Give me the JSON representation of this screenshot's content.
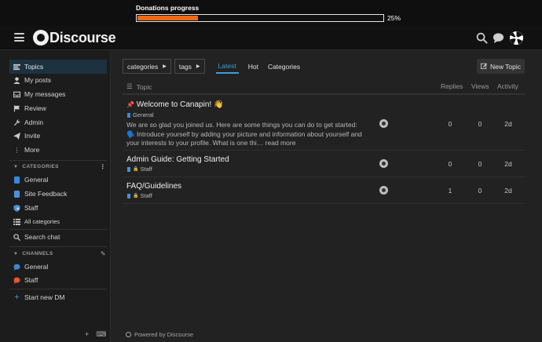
{
  "banner": {
    "title": "Donations progress",
    "percent_label": "25%",
    "progress": 0.25
  },
  "header": {
    "logo_text": "Discourse",
    "icons": [
      "hamburger-icon",
      "search-icon",
      "chat-icon",
      "user-avatar"
    ]
  },
  "sidebar": {
    "items": [
      {
        "label": "Topics",
        "icon": "topics-icon"
      },
      {
        "label": "My posts",
        "icon": "user-icon"
      },
      {
        "label": "My messages",
        "icon": "inbox-icon"
      },
      {
        "label": "Review",
        "icon": "flag-icon"
      },
      {
        "label": "Admin",
        "icon": "wrench-icon"
      },
      {
        "label": "Invite",
        "icon": "paper-plane-icon"
      },
      {
        "label": "More",
        "icon": "ellipsis-icon"
      }
    ],
    "categories_heading": "CATEGORIES",
    "categories": [
      {
        "label": "General",
        "color": "#3a87d6"
      },
      {
        "label": "Site Feedback",
        "color": "#4a90d6"
      },
      {
        "label": "Staff",
        "color": "#4a90d6"
      }
    ],
    "all_categories": "All categories",
    "search_chat": "Search chat",
    "channels_heading": "CHANNELS",
    "channels": [
      {
        "label": "General",
        "color": "#3a87d6"
      },
      {
        "label": "Staff",
        "color": "#e45735"
      }
    ],
    "start_dm": "Start new DM"
  },
  "nav": {
    "categories_drop": "categories",
    "tags_drop": "tags",
    "tabs": [
      "Latest",
      "Hot",
      "Categories"
    ],
    "active_tab": "Latest",
    "new_topic": "New Topic"
  },
  "table": {
    "headers": {
      "topic": "Topic",
      "replies": "Replies",
      "views": "Views",
      "activity": "Activity"
    },
    "rows": [
      {
        "title": "Welcome to Canapin! 👋",
        "category": "General",
        "excerpt": "We are so glad you joined us. Here are some things you can do to get started: 🗣️ Introduce yourself by adding your picture and information about yourself and your interests to your profile. What is one thi… read more",
        "replies": "0",
        "views": "0",
        "activity": "2d"
      },
      {
        "title": "Admin Guide: Getting Started",
        "category": "Staff",
        "replies": "0",
        "views": "0",
        "activity": "2d"
      },
      {
        "title": "FAQ/Guidelines",
        "category": "Staff",
        "replies": "1",
        "views": "0",
        "activity": "2d"
      }
    ]
  },
  "footer": {
    "powered_by": "Powered by Discourse"
  },
  "colors": {
    "accent": "#3d9cd6",
    "progress": "#f06a15",
    "active_bg": "#1d3240"
  }
}
